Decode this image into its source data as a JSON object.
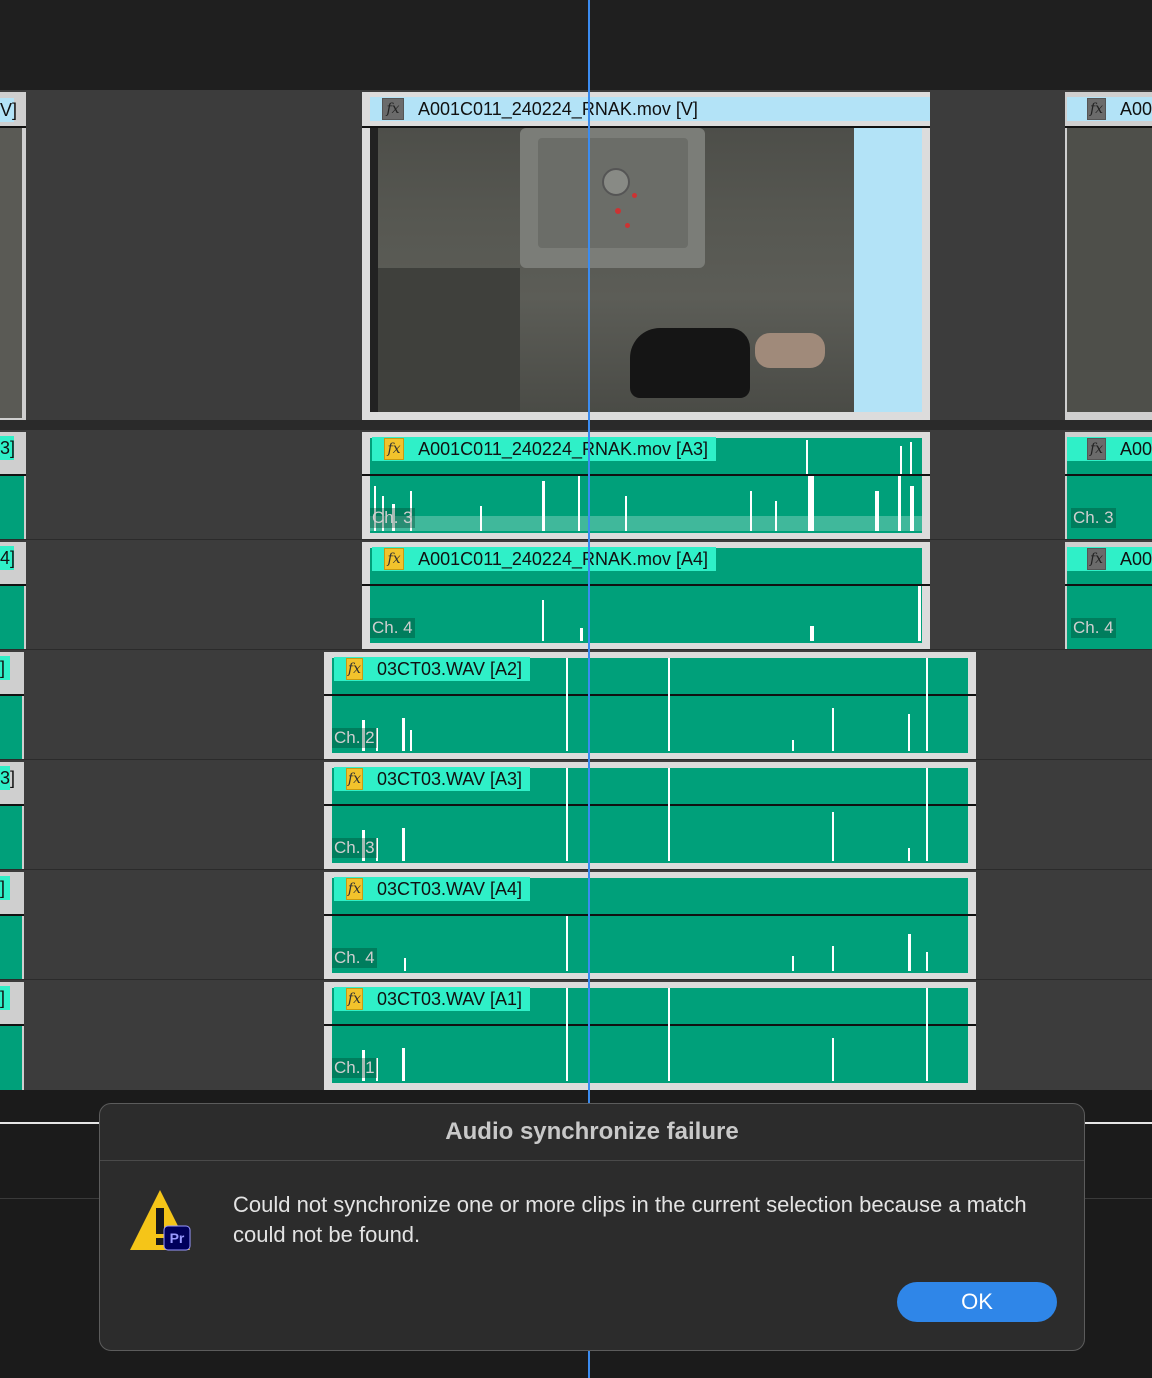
{
  "video_track": {
    "left_clip_label": "V]",
    "main_clip": {
      "name": "A001C011_240224_RNAK.mov [V]"
    },
    "right_clip_label": "A00"
  },
  "audio_tracks": [
    {
      "left_label": "3]",
      "clip_name": "A001C011_240224_RNAK.mov [A3]",
      "channel": "Ch. 3",
      "right_label": "A00",
      "right_channel": "Ch. 3"
    },
    {
      "left_label": "4]",
      "clip_name": "A001C011_240224_RNAK.mov [A4]",
      "channel": "Ch. 4",
      "right_label": "A00",
      "right_channel": "Ch. 4"
    },
    {
      "left_label": "]",
      "clip_name": "03CT03.WAV [A2]",
      "channel": "Ch. 2"
    },
    {
      "left_label": "3]",
      "clip_name": "03CT03.WAV [A3]",
      "channel": "Ch. 3"
    },
    {
      "left_label": "]",
      "clip_name": "03CT03.WAV [A4]",
      "channel": "Ch. 4"
    },
    {
      "left_label": "]",
      "clip_name": "03CT03.WAV [A1]",
      "channel": "Ch. 1"
    }
  ],
  "fx_icon": "fx-badge",
  "dialog": {
    "title": "Audio synchronize failure",
    "message": "Could not synchronize one or more clips in the current selection because a match could not be found.",
    "ok_label": "OK",
    "icon": "premiere-warning-icon",
    "icon_badge": "Pr"
  },
  "colors": {
    "audio_clip": "#00a07a",
    "audio_label": "#2ff0c8",
    "video_label": "#b3e3f7",
    "playhead": "#3b8cf0",
    "ok_button": "#2f86e8",
    "warning": "#f5c518"
  }
}
